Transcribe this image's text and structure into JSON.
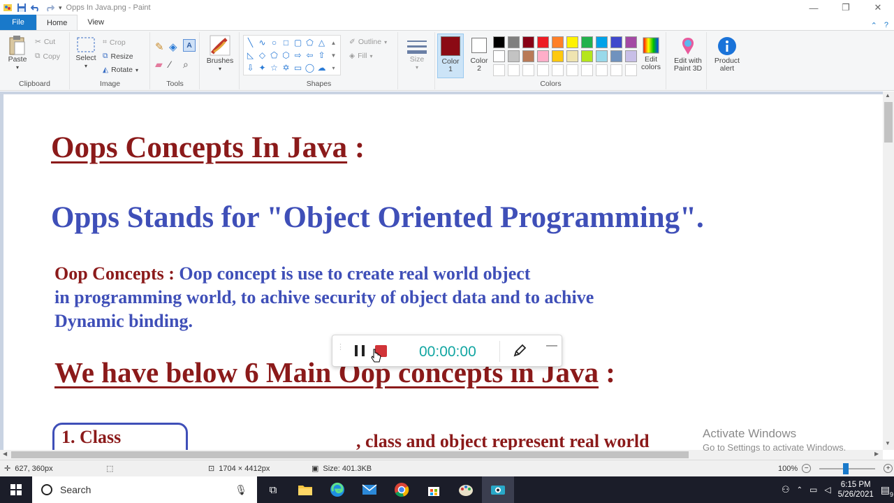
{
  "window": {
    "title": "Opps In Java.png - Paint"
  },
  "tabs": [
    {
      "label": "File"
    },
    {
      "label": "Home"
    },
    {
      "label": "View"
    }
  ],
  "ribbon": {
    "clipboard": {
      "label": "Clipboard",
      "paste": "Paste",
      "cut": "Cut",
      "copy": "Copy"
    },
    "image": {
      "label": "Image",
      "select": "Select",
      "crop": "Crop",
      "resize": "Resize",
      "rotate": "Rotate"
    },
    "tools": {
      "label": "Tools"
    },
    "brushes": {
      "label": "Brushes"
    },
    "shapes": {
      "label": "Shapes",
      "outline": "Outline",
      "fill": "Fill"
    },
    "size": {
      "label": "Size"
    },
    "colors": {
      "label": "Colors",
      "color1": "Color 1",
      "color2": "Color 2",
      "edit": "Edit colors",
      "color1_value": "#8b0a14",
      "color2_value": "#ffffff",
      "palette_row1": [
        "#000000",
        "#7f7f7f",
        "#880015",
        "#ed1c24",
        "#ff7f27",
        "#fff200",
        "#22b14c",
        "#00a2e8",
        "#3f48cc",
        "#a349a4"
      ],
      "palette_row2": [
        "#ffffff",
        "#c3c3c3",
        "#b97a57",
        "#ffaec9",
        "#ffc90e",
        "#efe4b0",
        "#b5e61d",
        "#99d9ea",
        "#7092be",
        "#c8bfe7"
      ]
    },
    "paint3d": "Edit with Paint 3D",
    "product_alert": "Product alert"
  },
  "document": {
    "title": "Oops Concepts In Java",
    "title_colon": " :",
    "subtitle": "Opps Stands for \"Object Oriented Programming\".",
    "para_label": "Oop Concepts :",
    "para_line1": " Oop concept is use to create real world object",
    "para_line2": "in programming world, to achive security of object data and to achive",
    "para_line3": "Dynamic binding.",
    "heading2": "We have below 6 Main Oop concepts in Java",
    "heading2_colon": " :",
    "class_box": "1. Class",
    "class_text": ", class and object represent real world"
  },
  "recorder": {
    "time": "00:00:00"
  },
  "watermark": {
    "line1": "Activate Windows",
    "line2": "Go to Settings to activate Windows."
  },
  "status": {
    "cursor": "627, 360px",
    "dimensions": "1704 × 4412px",
    "size": "Size: 401.3KB",
    "zoom": "100%"
  },
  "taskbar": {
    "search": "Search",
    "time": "6:15 PM",
    "date": "5/26/2021",
    "notifications": "9"
  }
}
